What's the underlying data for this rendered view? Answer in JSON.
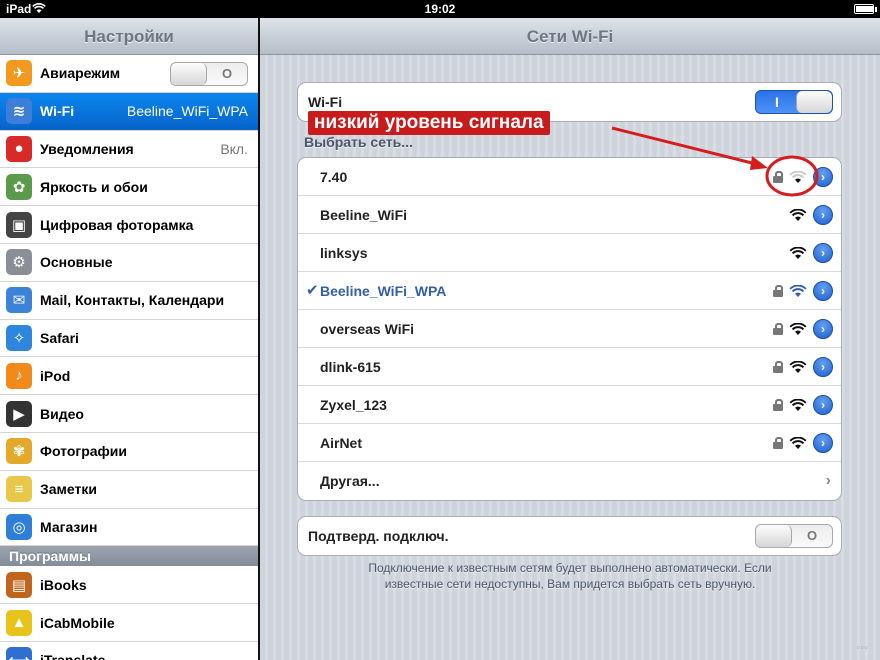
{
  "statusbar": {
    "device": "iPad",
    "time": "19:02",
    "battery_level": 0.95
  },
  "left": {
    "title": "Настройки",
    "items": [
      {
        "label": "Авиарежим",
        "icon": "airplane-icon",
        "toggle": "O"
      },
      {
        "label": "Wi-Fi",
        "icon": "wifi-icon",
        "value": "Beeline_WiFi_WPA",
        "selected": true
      },
      {
        "label": "Уведомления",
        "icon": "notifications-icon",
        "value": "Вкл."
      },
      {
        "label": "Яркость и обои",
        "icon": "brightness-icon"
      },
      {
        "label": "Цифровая фоторамка",
        "icon": "photo-frame-icon"
      },
      {
        "label": "Основные",
        "icon": "gear-icon"
      },
      {
        "label": "Mail, Контакты, Календари",
        "icon": "mail-icon"
      },
      {
        "label": "Safari",
        "icon": "safari-icon"
      },
      {
        "label": "iPod",
        "icon": "ipod-icon"
      },
      {
        "label": "Видео",
        "icon": "video-icon"
      },
      {
        "label": "Фотографии",
        "icon": "photos-icon"
      },
      {
        "label": "Заметки",
        "icon": "notes-icon"
      },
      {
        "label": "Магазин",
        "icon": "store-icon"
      }
    ],
    "section_header": "Программы",
    "apps": [
      {
        "label": "iBooks",
        "icon": "ibooks-icon"
      },
      {
        "label": "iCabMobile",
        "icon": "icabmobile-icon"
      },
      {
        "label": "iTranslate",
        "icon": "itranslate-icon"
      }
    ]
  },
  "right": {
    "title": "Сети Wi-Fi",
    "wifi": {
      "label": "Wi-Fi",
      "toggle": "I"
    },
    "choose_label": "Выбрать сеть...",
    "networks": [
      {
        "name": "7.40",
        "locked": true,
        "signal": 1,
        "selected": false
      },
      {
        "name": "Beeline_WiFi",
        "locked": false,
        "signal": 3,
        "selected": false
      },
      {
        "name": "linksys",
        "locked": false,
        "signal": 3,
        "selected": false
      },
      {
        "name": "Beeline_WiFi_WPA",
        "locked": true,
        "signal": 3,
        "selected": true
      },
      {
        "name": "overseas WiFi",
        "locked": true,
        "signal": 3,
        "selected": false
      },
      {
        "name": "dlink-615",
        "locked": true,
        "signal": 3,
        "selected": false
      },
      {
        "name": "Zyxel_123",
        "locked": true,
        "signal": 3,
        "selected": false
      },
      {
        "name": "AirNet",
        "locked": true,
        "signal": 3,
        "selected": false
      }
    ],
    "other_label": "Другая...",
    "ask_join": {
      "label": "Подтверд. подключ.",
      "toggle": "O"
    },
    "footer_line1": "Подключение к известным сетям будет выполнено автоматически. Если",
    "footer_line2": "известные сети недоступны, Вам придется выбрать сеть вручную."
  },
  "annotation": {
    "text": "низкий уровень сигнала",
    "color": "#d41e1e"
  },
  "watermark": "◦◦◦"
}
